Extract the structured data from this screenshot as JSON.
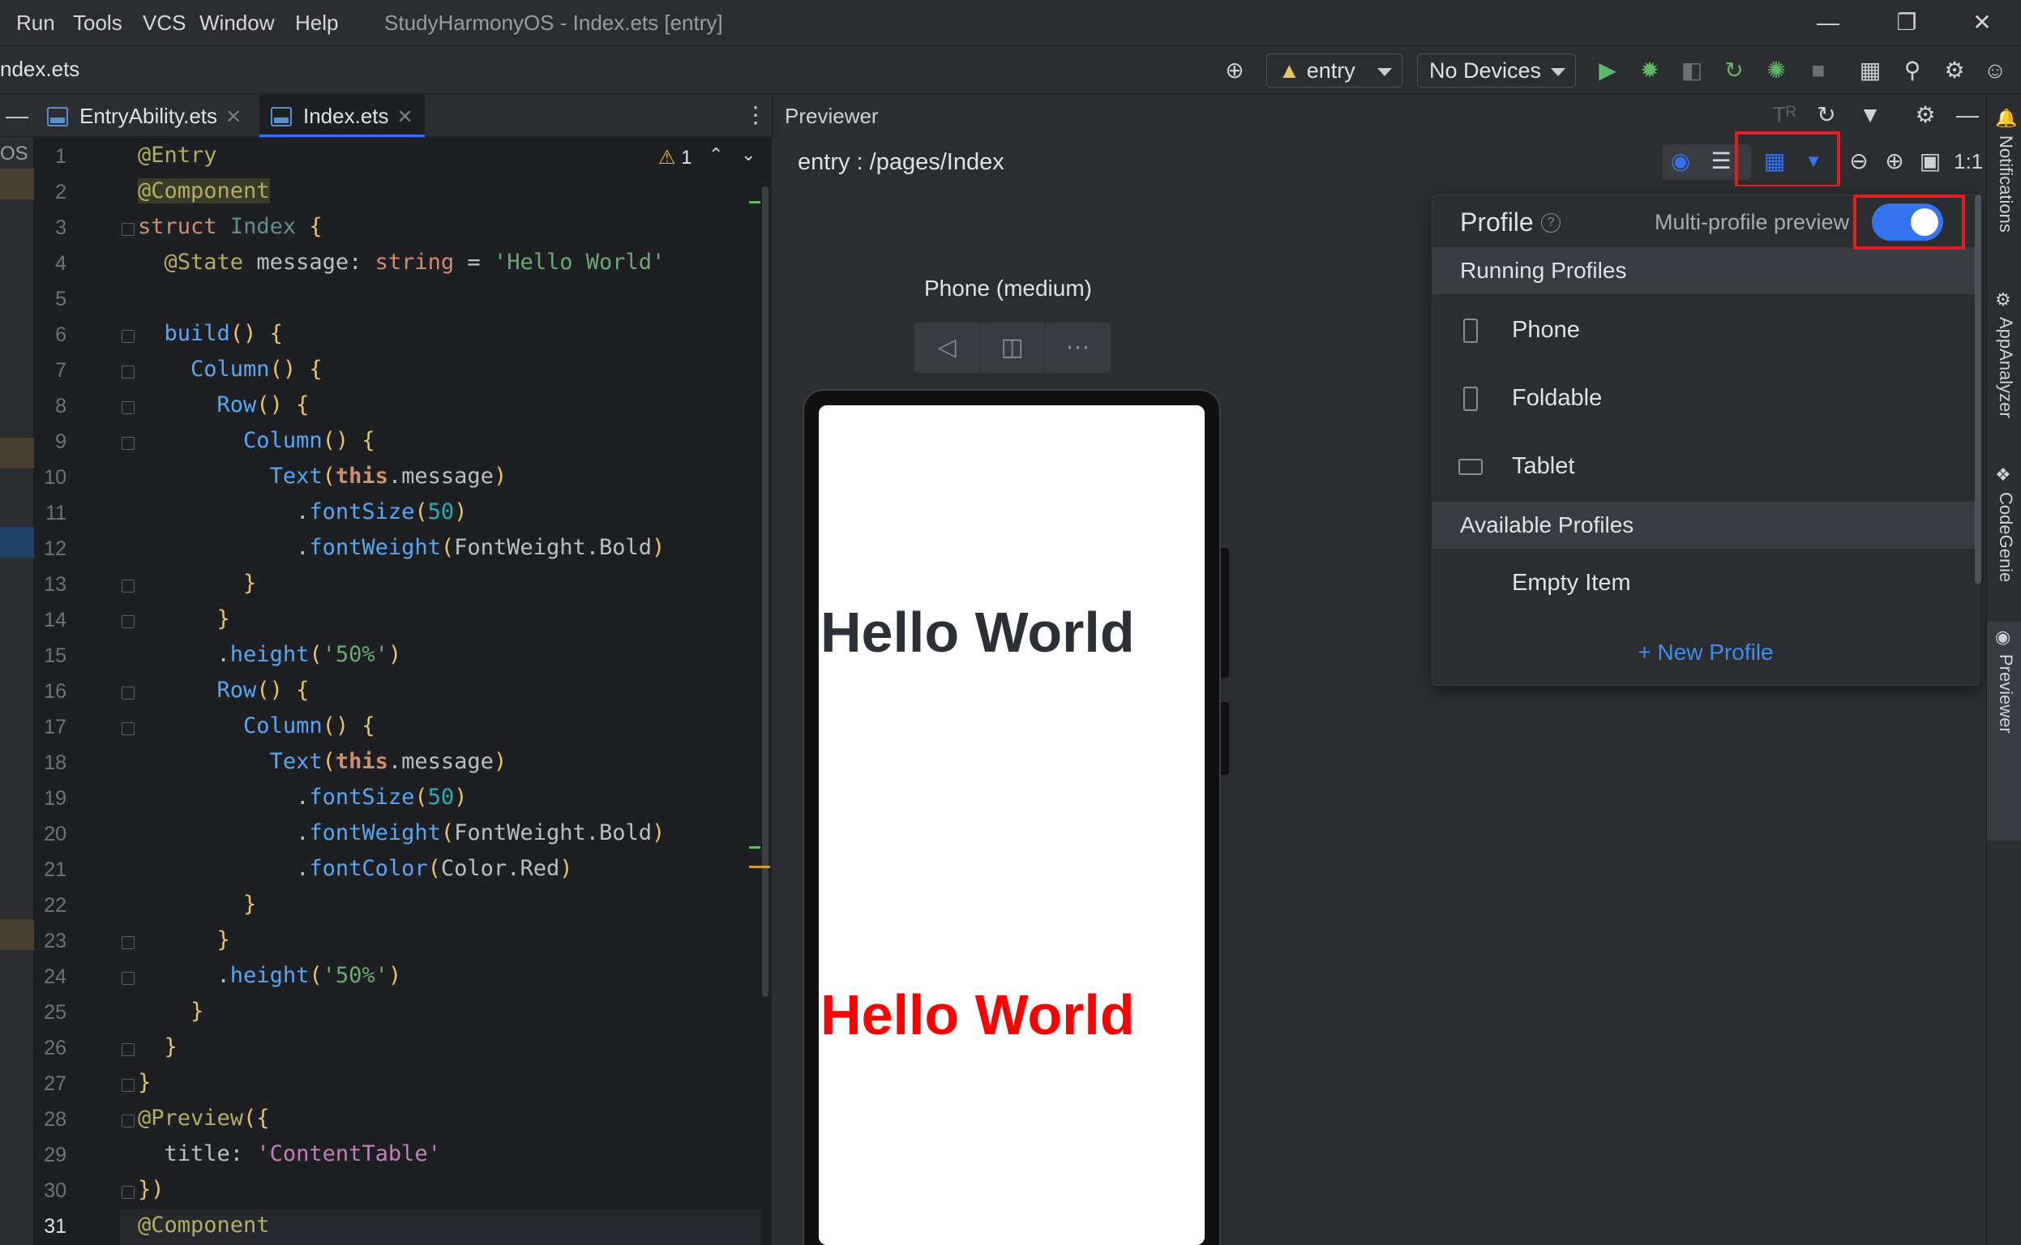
{
  "menu": {
    "items": [
      "Run",
      "Tools",
      "VCS",
      "Window",
      "Help"
    ],
    "window_title": "StudyHarmonyOS - Index.ets [entry]"
  },
  "toolbar": {
    "breadcrumb": "ndex.ets",
    "module": "entry",
    "device": "No Devices"
  },
  "editor": {
    "tabs": [
      {
        "label": "EntryAbility.ets"
      },
      {
        "label": "Index.ets"
      }
    ],
    "left_label": "OS",
    "warnings": "1",
    "line_numbers": [
      "1",
      "2",
      "3",
      "4",
      "5",
      "6",
      "7",
      "8",
      "9",
      "10",
      "11",
      "12",
      "13",
      "14",
      "15",
      "16",
      "17",
      "18",
      "19",
      "20",
      "21",
      "22",
      "23",
      "24",
      "25",
      "26",
      "27",
      "28",
      "29",
      "30",
      "31"
    ]
  },
  "previewer": {
    "title": "Previewer",
    "route": "entry : /pages/Index",
    "device_label": "Phone (medium)",
    "hello_black": "Hello World",
    "hello_red": "Hello World",
    "zoom_label": "1:1"
  },
  "profile_panel": {
    "title": "Profile",
    "multi_label": "Multi-profile preview",
    "toggle_on": true,
    "running_header": "Running Profiles",
    "running": [
      "Phone",
      "Foldable",
      "Tablet"
    ],
    "available_header": "Available Profiles",
    "available": [
      "Empty Item"
    ],
    "new_profile": "+ New Profile"
  },
  "right_strip": [
    "Notifications",
    "AppAnalyzer",
    "CodeGenie",
    "Previewer"
  ],
  "colors": {
    "accent": "#3574f0",
    "highlight_box": "#e02020",
    "red_text": "#ff0000",
    "link": "#3d8ef0"
  }
}
